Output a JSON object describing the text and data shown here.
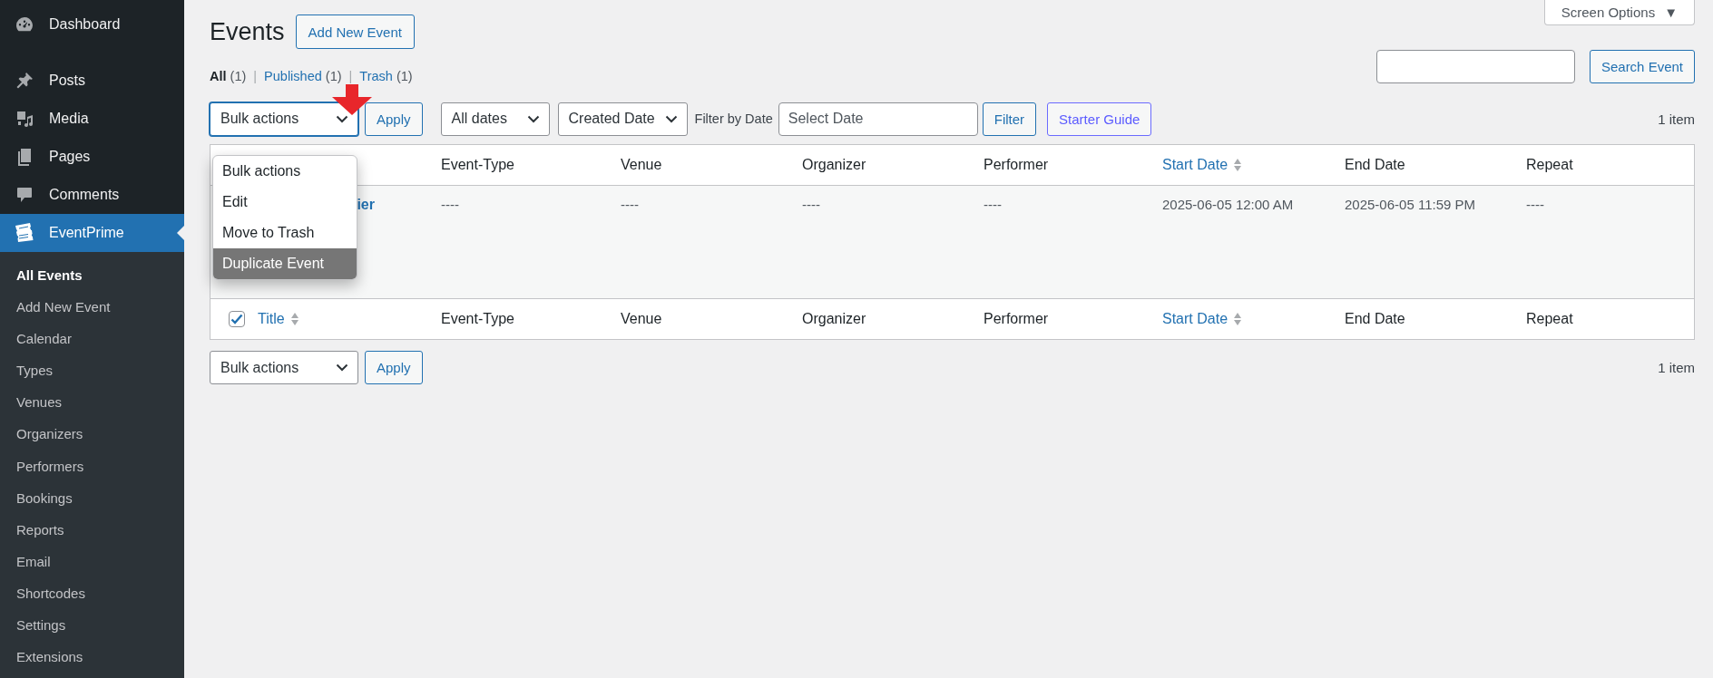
{
  "sidebar": {
    "items": [
      {
        "label": "Dashboard",
        "selected": false
      },
      {
        "label": "Posts",
        "selected": false
      },
      {
        "label": "Media",
        "selected": false
      },
      {
        "label": "Pages",
        "selected": false
      },
      {
        "label": "Comments",
        "selected": false
      },
      {
        "label": "EventPrime",
        "selected": true
      }
    ],
    "submenu": [
      {
        "label": "All Events",
        "selected": true
      },
      {
        "label": "Add New Event",
        "selected": false
      },
      {
        "label": "Calendar",
        "selected": false
      },
      {
        "label": "Types",
        "selected": false
      },
      {
        "label": "Venues",
        "selected": false
      },
      {
        "label": "Organizers",
        "selected": false
      },
      {
        "label": "Performers",
        "selected": false
      },
      {
        "label": "Bookings",
        "selected": false
      },
      {
        "label": "Reports",
        "selected": false
      },
      {
        "label": "Email",
        "selected": false
      },
      {
        "label": "Shortcodes",
        "selected": false
      },
      {
        "label": "Settings",
        "selected": false
      },
      {
        "label": "Extensions",
        "selected": false
      }
    ]
  },
  "screen_options": {
    "label": "Screen Options",
    "caret": "▼"
  },
  "page": {
    "title": "Events",
    "add_button": "Add New Event"
  },
  "status_links": {
    "separator": "|",
    "items": [
      {
        "label": "All",
        "count": "(1)",
        "selected": true
      },
      {
        "label": "Published",
        "count": "(1)",
        "selected": false
      },
      {
        "label": "Trash",
        "count": "(1)",
        "selected": false
      }
    ]
  },
  "search": {
    "button": "Search Event"
  },
  "toolbar": {
    "bulk_select": "Bulk actions",
    "apply": "Apply",
    "dates": "All dates",
    "sort": "Created Date",
    "filter_label": "Filter by Date",
    "date_placeholder": "Select Date",
    "filter": "Filter",
    "guide": "Starter Guide",
    "count": "1 item"
  },
  "dropdown": {
    "options": [
      {
        "label": "Bulk actions",
        "selected": false
      },
      {
        "label": "Edit",
        "selected": false
      },
      {
        "label": "Move to Trash",
        "selected": false
      },
      {
        "label": "Duplicate Event",
        "selected": true
      }
    ]
  },
  "table": {
    "header_columns": [
      {
        "label": "Event-Type",
        "sortable": false
      },
      {
        "label": "Venue",
        "sortable": false
      },
      {
        "label": "Organizer",
        "sortable": false
      },
      {
        "label": "Performer",
        "sortable": false
      },
      {
        "label": "Start Date",
        "sortable": true
      },
      {
        "label": "End Date",
        "sortable": false
      },
      {
        "label": "Repeat",
        "sortable": false
      }
    ],
    "rows": [
      {
        "title": "ier",
        "cells": [
          "----",
          "----",
          "----",
          "----",
          "2025-06-05 12:00 AM",
          "2025-06-05 11:59 PM",
          "----"
        ]
      }
    ],
    "footer": {
      "select_all_checked": true,
      "columns": [
        {
          "label": "Title",
          "sortable": true
        },
        {
          "label": "Event-Type",
          "sortable": false
        },
        {
          "label": "Venue",
          "sortable": false
        },
        {
          "label": "Organizer",
          "sortable": false
        },
        {
          "label": "Performer",
          "sortable": false
        },
        {
          "label": "Start Date",
          "sortable": true
        },
        {
          "label": "End Date",
          "sortable": false
        },
        {
          "label": "Repeat",
          "sortable": false
        }
      ]
    }
  },
  "bottom": {
    "bulk_select": "Bulk actions",
    "apply": "Apply",
    "count": "1 item"
  }
}
